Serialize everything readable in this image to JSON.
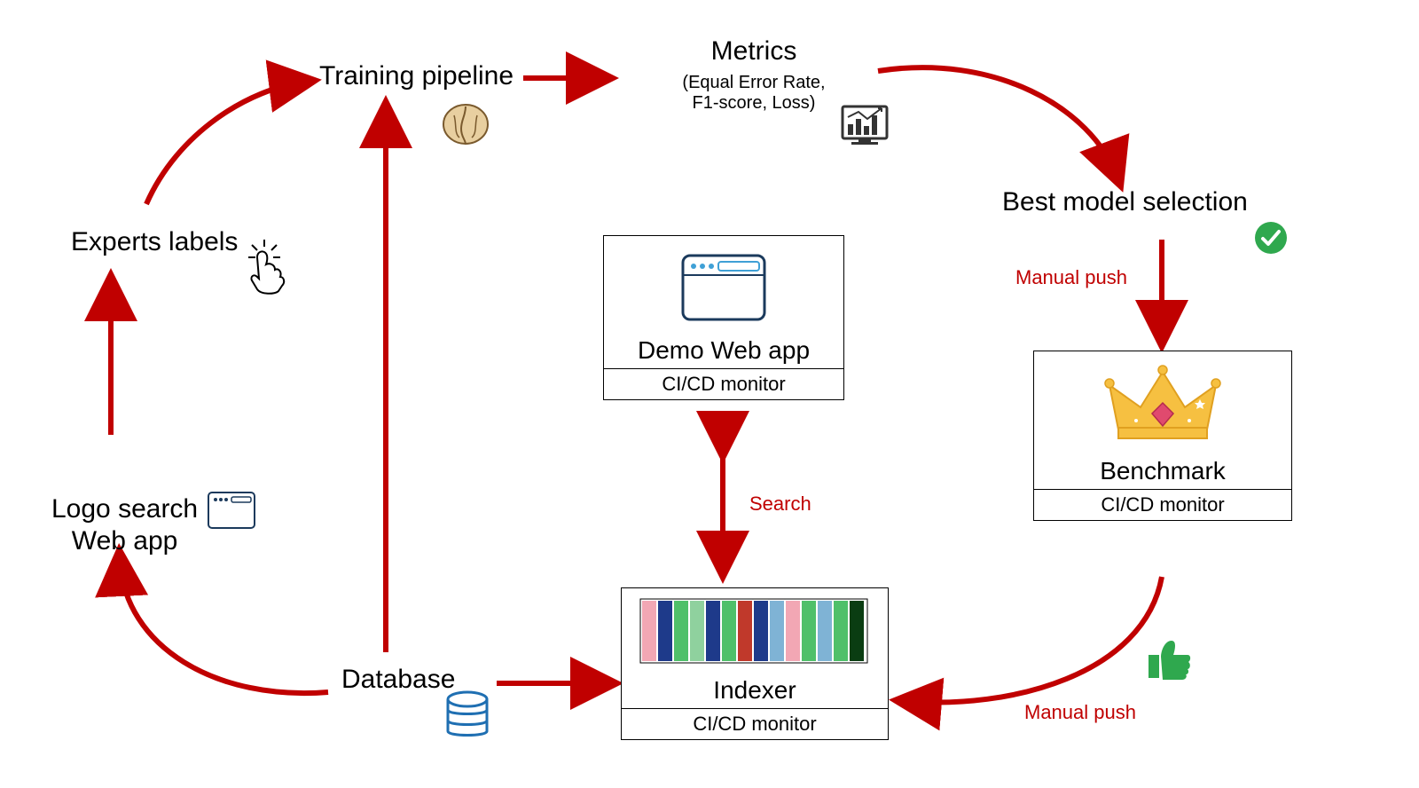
{
  "nodes": {
    "training": {
      "label": "Training pipeline"
    },
    "metrics": {
      "label": "Metrics",
      "sub": "(Equal Error Rate,\nF1-score, Loss)"
    },
    "bestmodel": {
      "label": "Best model selection"
    },
    "experts": {
      "label": "Experts labels"
    },
    "logosearch": {
      "label": "Logo search\nWeb app"
    },
    "database": {
      "label": "Database"
    },
    "demoapp": {
      "label": "Demo Web app",
      "monitor": "CI/CD monitor"
    },
    "indexer": {
      "label": "Indexer",
      "monitor": "CI/CD monitor"
    },
    "benchmark": {
      "label": "Benchmark",
      "monitor": "CI/CD monitor"
    }
  },
  "edgeLabels": {
    "search": "Search",
    "manualPush1": "Manual push",
    "manualPush2": "Manual push"
  },
  "colors": {
    "arrow": "#c00000",
    "boxEdge": "#000000",
    "green": "#2fa84e",
    "blue": "#1f6fb2",
    "gold": "#f6c041",
    "ruby": "#e04a6e"
  }
}
